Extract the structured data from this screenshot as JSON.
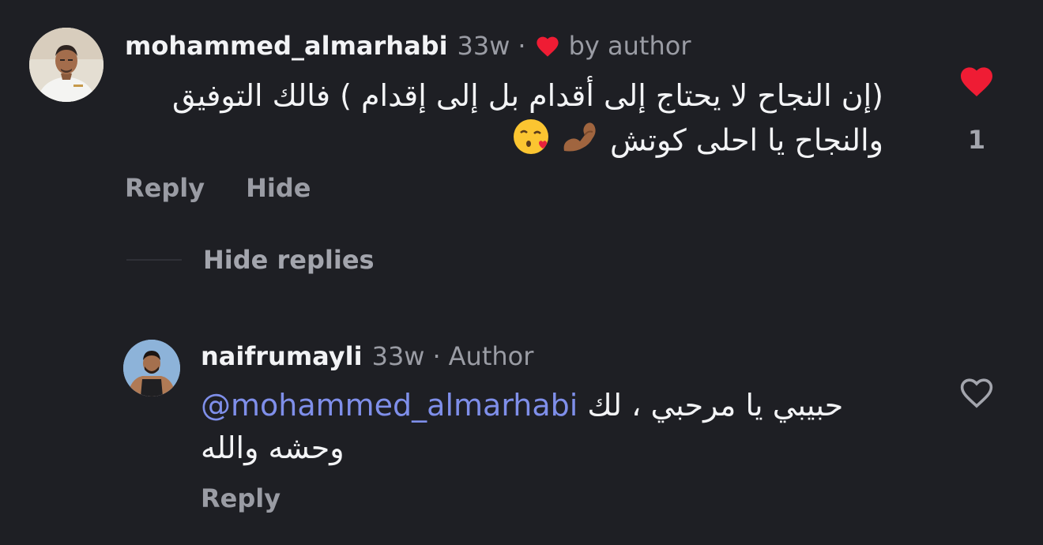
{
  "comments": [
    {
      "username": "mohammed_almarhabi",
      "time": "33w",
      "separator": "·",
      "liked_by": "by author",
      "text_line1": "(إن النجاح لا يحتاج إلى أقدام بل إلى إقدام ) فالك التوفيق",
      "text_line2": "والنجاح يا احلى كوتش",
      "reply_label": "Reply",
      "hide_label": "Hide",
      "like_count": "1",
      "liked": true
    },
    {
      "username": "naifrumayli",
      "time": "33w",
      "separator": "·",
      "badge": "Author",
      "mention": "@mohammed_almarhabi",
      "text_line1_rest": "حبيبي يا مرحبي ، لك",
      "text_line2": "وحشه والله",
      "reply_label": "Reply",
      "liked": false
    }
  ],
  "hide_replies_label": "Hide replies",
  "colors": {
    "background": "#1e1f24",
    "heart_red": "#ef1c34",
    "mention_blue": "#7f8fea",
    "muted": "#9a9ca4"
  }
}
